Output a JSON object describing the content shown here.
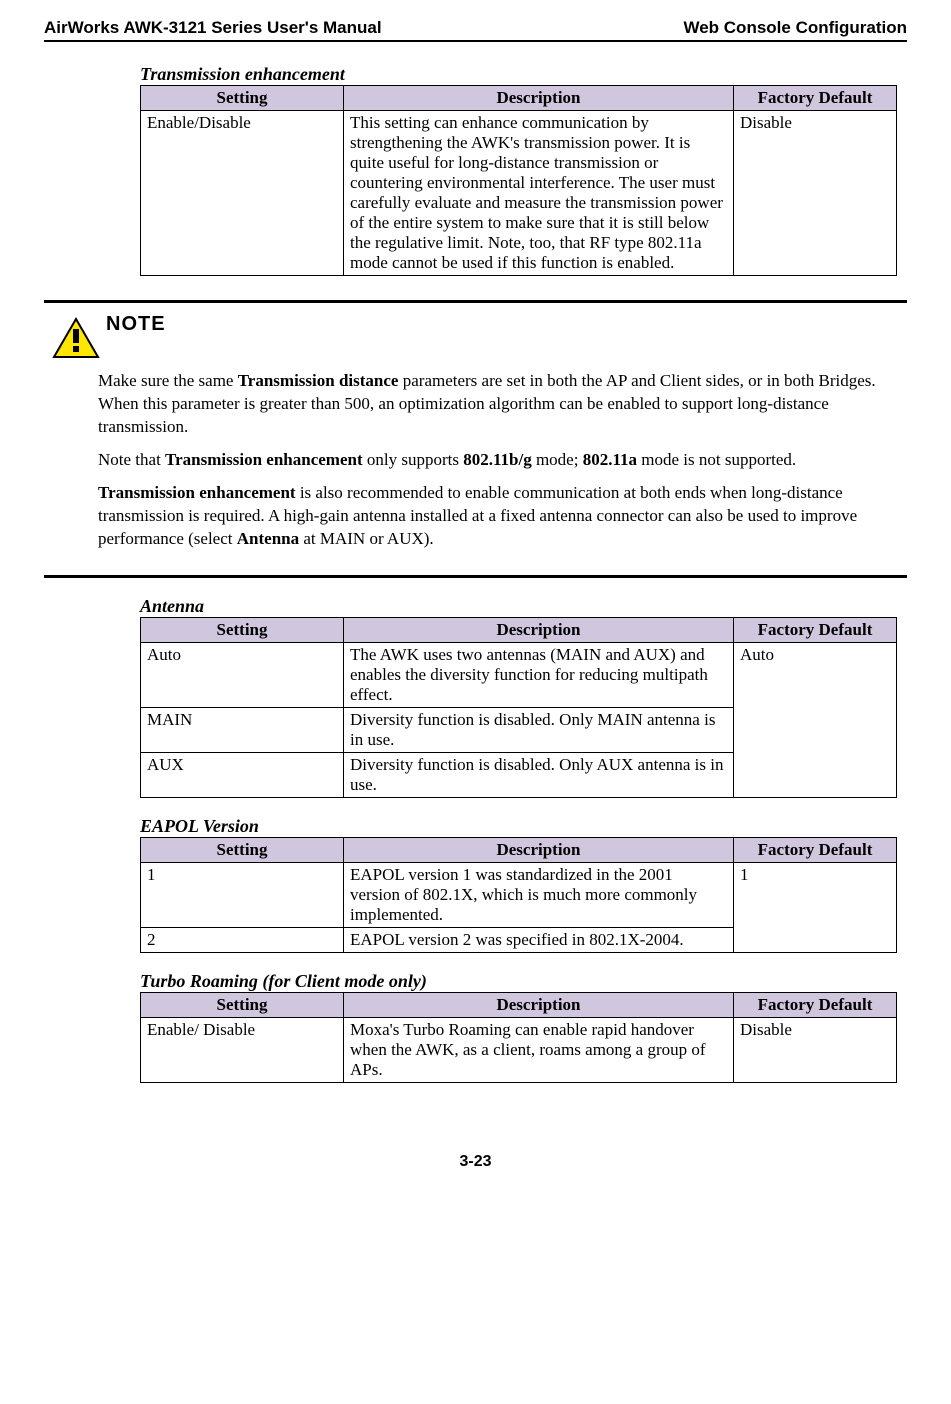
{
  "header": {
    "left": "AirWorks AWK-3121 Series User's Manual",
    "right": "Web Console Configuration"
  },
  "columns": {
    "setting": "Setting",
    "description": "Description",
    "default": "Factory Default"
  },
  "tx_enhancement": {
    "caption": "Transmission enhancement",
    "row": {
      "setting": "Enable/Disable",
      "description": "This setting can enhance communication by strengthening the AWK's transmission power. It is quite useful for long-distance transmission or countering environmental interference. The user must carefully evaluate and measure the transmission power of the entire system to make sure that it is still below the regulative limit. Note, too, that RF type 802.11a mode cannot be used if this function is enabled.",
      "default": "Disable"
    }
  },
  "note": {
    "label": "NOTE",
    "p1a": "Make sure the same ",
    "p1b": "Transmission distance",
    "p1c": " parameters are set in both the AP and Client sides, or in both Bridges. When this parameter is greater than 500, an optimization algorithm can be enabled to support long-distance transmission.",
    "p2a": "Note that ",
    "p2b": "Transmission enhancement",
    "p2c": " only supports ",
    "p2d": "802.11b/g",
    "p2e": " mode; ",
    "p2f": "802.11a",
    "p2g": " mode is not supported.",
    "p3a": "Transmission enhancement",
    "p3b": " is also recommended to enable communication at both ends when long-distance transmission is required. A high-gain antenna installed at a fixed antenna connector can also be used to improve performance (select ",
    "p3c": "Antenna",
    "p3d": " at MAIN or AUX)."
  },
  "antenna": {
    "caption": "Antenna",
    "rows": [
      {
        "setting": "Auto",
        "description": "The AWK uses two antennas (MAIN and AUX) and enables the diversity function for reducing multipath effect."
      },
      {
        "setting": "MAIN",
        "description": "Diversity function is disabled. Only MAIN antenna is in use."
      },
      {
        "setting": "AUX",
        "description": "Diversity function is disabled. Only AUX antenna is in use."
      }
    ],
    "default": "Auto"
  },
  "eapol": {
    "caption": "EAPOL Version",
    "rows": [
      {
        "setting": "1",
        "description": "EAPOL version 1 was standardized in the 2001 version of 802.1X, which is much more commonly implemented."
      },
      {
        "setting": "2",
        "description": "EAPOL version 2 was specified in 802.1X-2004."
      }
    ],
    "default": "1"
  },
  "turbo": {
    "caption": "Turbo Roaming (for Client mode only)",
    "row": {
      "setting": "Enable/ Disable",
      "description": "Moxa's Turbo Roaming can enable rapid handover when the AWK, as a client, roams among a group of APs.",
      "default": "Disable"
    }
  },
  "footer": {
    "page": "3-23"
  }
}
